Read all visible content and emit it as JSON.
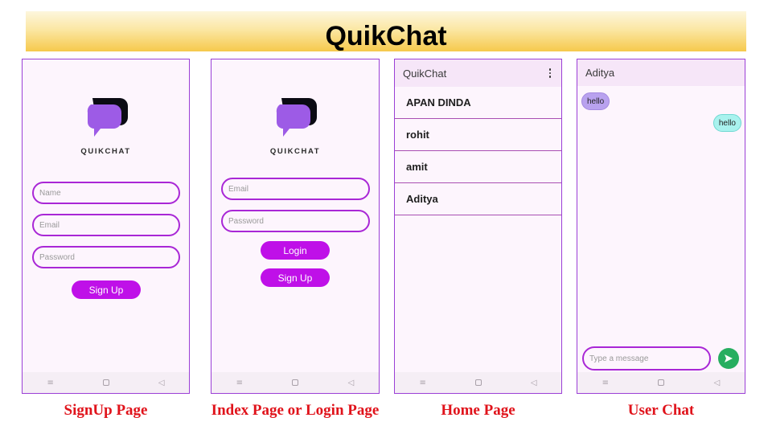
{
  "title": "QuikChat",
  "logo_text": "QUIKCHAT",
  "colors": {
    "accent": "#bf10e8",
    "field_border": "#a927d6",
    "phone_border": "#9b3fd6",
    "caption": "#e0131b",
    "send": "#27ae60"
  },
  "icons": {
    "logo": "chat-bubbles-icon",
    "menu": "more-vert-icon",
    "send": "send-icon",
    "nav_menu": "nav-menu-icon",
    "nav_home": "nav-home-icon",
    "nav_back": "nav-back-icon"
  },
  "navbar": {
    "menu": "≡",
    "back": "◁"
  },
  "signup": {
    "caption": "SignUp Page",
    "name_placeholder": "Name",
    "email_placeholder": "Email",
    "password_placeholder": "Password",
    "signup_button": "Sign Up"
  },
  "login": {
    "caption": "Index Page or Login Page",
    "email_placeholder": "Email",
    "password_placeholder": "Password",
    "login_button": "Login",
    "signup_button": "Sign Up"
  },
  "home": {
    "caption": "Home Page",
    "app_title": "QuikChat",
    "users": [
      "APAN DINDA",
      "rohit",
      "amit",
      "Aditya"
    ]
  },
  "chat": {
    "caption": "User Chat",
    "contact_name": "Aditya",
    "incoming_message": "hello",
    "outgoing_message": "hello",
    "input_placeholder": "Type a message"
  }
}
